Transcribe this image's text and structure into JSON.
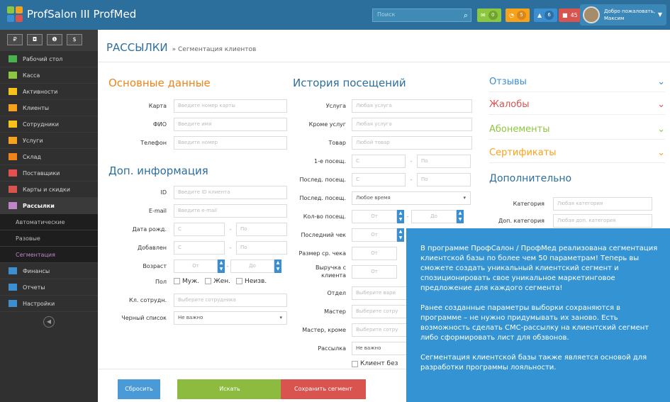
{
  "app": {
    "title": "ProfSalon III ProfMed"
  },
  "search": {
    "placeholder": "Поиск"
  },
  "top_badges": [
    {
      "icon": "envelope-icon",
      "count": "0",
      "color": "#8dc63f"
    },
    {
      "icon": "clock-icon",
      "count": "5",
      "color": "#f7a21b"
    },
    {
      "icon": "bell-icon",
      "count": "6",
      "color": "#3b8ed0"
    },
    {
      "icon": "gift-icon",
      "count": "45",
      "color": "#d9534f"
    }
  ],
  "user": {
    "greeting": "Добро пожаловать,",
    "name": "Максим"
  },
  "sidebar": {
    "buttons": [
      "₽",
      "◘",
      "❶",
      "$"
    ],
    "items": [
      {
        "label": "Рабочий стол",
        "icon": "home-icon",
        "color": "#4caf50"
      },
      {
        "label": "Касса",
        "icon": "dollar-icon",
        "color": "#8dc63f"
      },
      {
        "label": "Активности",
        "icon": "user-icon",
        "color": "#f7c21b"
      },
      {
        "label": "Клиенты",
        "icon": "users-icon",
        "color": "#f7a21b"
      },
      {
        "label": "Сотрудники",
        "icon": "person-icon",
        "color": "#f7c21b"
      },
      {
        "label": "Услуги",
        "icon": "scissors-icon",
        "color": "#f7a21b"
      },
      {
        "label": "Склад",
        "icon": "box-icon",
        "color": "#f0841b"
      },
      {
        "label": "Поставщики",
        "icon": "truck-icon",
        "color": "#e2504f"
      },
      {
        "label": "Карты и скидки",
        "icon": "card-icon",
        "color": "#d9534f"
      },
      {
        "label": "Рассылки",
        "icon": "mail-icon",
        "color": "#c084c8"
      },
      {
        "label": "Автоматические",
        "icon": "",
        "color": ""
      },
      {
        "label": "Разовые",
        "icon": "",
        "color": ""
      },
      {
        "label": "Сегментация",
        "icon": "",
        "color": ""
      },
      {
        "label": "Финансы",
        "icon": "finance-icon",
        "color": "#3b8ed0"
      },
      {
        "label": "Отчеты",
        "icon": "report-icon",
        "color": "#3b8ed0"
      },
      {
        "label": "Настройки",
        "icon": "gear-icon",
        "color": "#3b8ed0"
      }
    ]
  },
  "breadcrumb": {
    "title": "РАССЫЛКИ",
    "sub": "» Сегментация клиентов"
  },
  "basic": {
    "title": "Основные данные",
    "fields": [
      {
        "label": "Карта",
        "placeholder": "Введите номер карты"
      },
      {
        "label": "ФИО",
        "placeholder": "Введите имя"
      },
      {
        "label": "Телефон",
        "placeholder": "Введите номер"
      }
    ]
  },
  "extra": {
    "title": "Доп. информация",
    "fields": [
      {
        "label": "ID",
        "placeholder": "Введите ID клиента"
      },
      {
        "label": "E-mail",
        "placeholder": "Введите e-mail"
      }
    ],
    "birth": {
      "label": "Дата рожд.",
      "from": "С",
      "to": "По"
    },
    "added": {
      "label": "Добавлен",
      "from": "С",
      "to": "По"
    },
    "age": {
      "label": "Возраст",
      "from": "От",
      "to": "До"
    },
    "gender": {
      "label": "Пол",
      "options": [
        "Муж.",
        "Жен.",
        "Неизв."
      ]
    },
    "employee": {
      "label": "Кл. сотрудн.",
      "placeholder": "Выберите сотрудника"
    },
    "blacklist": {
      "label": "Черный список",
      "value": "Не важно"
    }
  },
  "history": {
    "title": "История посещений",
    "service": {
      "label": "Услуга",
      "placeholder": "Любая услуга"
    },
    "except": {
      "label": "Кроме услуг",
      "placeholder": "Любая услуга"
    },
    "product": {
      "label": "Товар",
      "placeholder": "Любой товар"
    },
    "first": {
      "label": "1-е посещ.",
      "from": "С",
      "to": "По"
    },
    "last": {
      "label": "Послед. посещ.",
      "from": "С",
      "to": "По"
    },
    "lastsel": {
      "label": "Послед. посещ.",
      "value": "Любое время"
    },
    "count": {
      "label": "Кол-во посещ.",
      "from": "От",
      "to": "До"
    },
    "lastcheck": {
      "label": "Последний чек",
      "from": "От"
    },
    "avgcheck": {
      "label": "Размер ср. чека",
      "from": "От"
    },
    "revenue": {
      "label1": "Выручка с",
      "label2": "клиента",
      "from": "От"
    },
    "dept": {
      "label": "Отдел",
      "placeholder": "Выберите вари"
    },
    "master": {
      "label": "Мастер",
      "placeholder": "Выберите сотру"
    },
    "masterex": {
      "label": "Мастер, кроме",
      "placeholder": "Выберите сотру"
    },
    "mailing": {
      "label": "Рассылка",
      "value": "Не важно"
    },
    "nocheck": "Клиент без"
  },
  "right": {
    "sections": [
      {
        "title": "Отзывы",
        "color": "#3b8ed0",
        "chev": "#3b8ed0"
      },
      {
        "title": "Жалобы",
        "color": "#d9534f",
        "chev": "#d9534f"
      },
      {
        "title": "Абонементы",
        "color": "#8dc63f",
        "chev": "#8dc63f"
      },
      {
        "title": "Сертификаты",
        "color": "#f7a21b",
        "chev": "#f7a21b"
      }
    ],
    "additional": {
      "title": "Дополнительно",
      "cat": {
        "label": "Категория",
        "placeholder": "Любая категория"
      },
      "dopcat": {
        "label": "Доп. категория",
        "placeholder": "Любая доп. категория"
      }
    }
  },
  "buttons": {
    "reset": "Сбросить",
    "search": "Искать",
    "save": "Сохранить сегмент"
  },
  "popup": {
    "p1": "В программе ПрофСалон / ПрофМед реализована сегментация клиентской базы по более чем 50 параметрам! Теперь вы сможете создать уникальный клиентский сегмент и спозиционировать свое уникальное маркетинговое предложение для каждого сегмента!",
    "p2": "Ранее созданные параметры выборки сохраняются в программе – не нужно придумывать их заново. Есть возможность сделать СМС-рассылку на клиентский сегмент либо сформировать лист для обзвонов.",
    "p3": "Сегментация клиентской базы также является основой для разработки программы лояльности."
  }
}
